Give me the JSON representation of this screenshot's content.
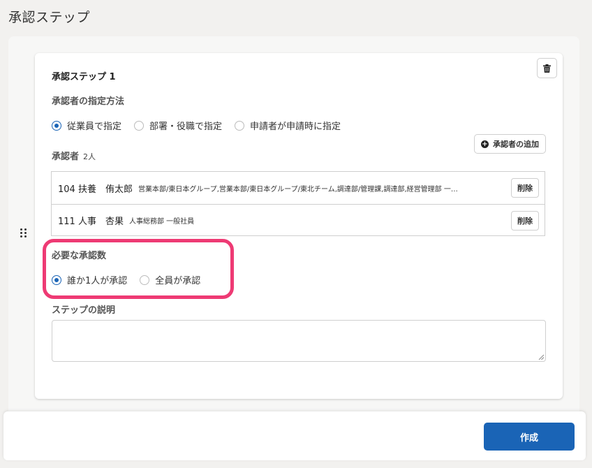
{
  "page": {
    "title": "承認ステップ"
  },
  "step": {
    "title": "承認ステップ 1",
    "method": {
      "label": "承認者の指定方法",
      "options": [
        "従業員で指定",
        "部署・役職で指定",
        "申請者が申請時に指定"
      ],
      "selected": "従業員で指定"
    },
    "approvers": {
      "label": "承認者",
      "count": "2人",
      "add_label": "承認者の追加",
      "delete_label": "削除",
      "rows": [
        {
          "name": "104 扶養　侑太郎",
          "dept": "営業本部/東日本グループ,営業本部/東日本グループ/東北チーム,調達部/管理課,調達部,経営管理部 一…"
        },
        {
          "name": "111 人事　杏果",
          "dept": "人事総務部 一般社員"
        }
      ]
    },
    "required": {
      "label": "必要な承認数",
      "options": [
        "誰か1人が承認",
        "全員が承認"
      ],
      "selected": "誰か1人が承認"
    },
    "description": {
      "label": "ステップの説明",
      "value": ""
    }
  },
  "footer": {
    "create_label": "作成"
  },
  "colors": {
    "accent": "#1a64b6",
    "highlight": "#ee3a74"
  },
  "icons": {
    "delete_step": "trash-icon",
    "add": "plus-circle-icon",
    "drag": "drag-handle-icon"
  }
}
